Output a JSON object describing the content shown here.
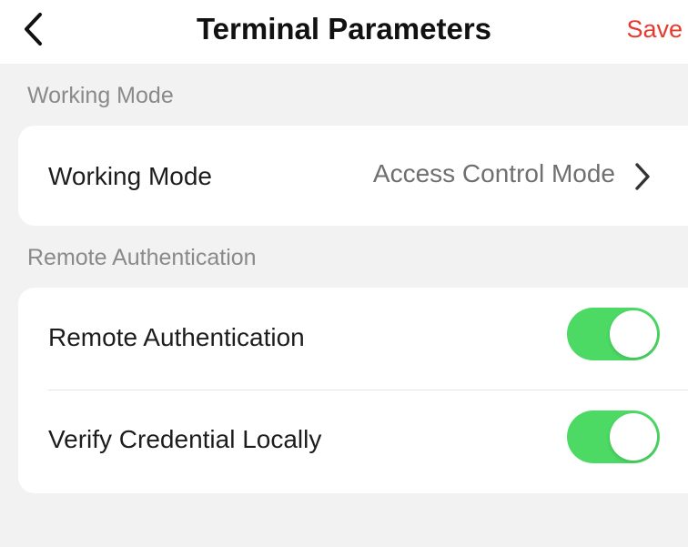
{
  "header": {
    "title": "Terminal Parameters",
    "save_label": "Save",
    "back_icon": "chevron-left-icon"
  },
  "colors": {
    "accent": "#e63a2e",
    "toggle_on": "#4cd964",
    "background": "#f2f2f2"
  },
  "sections": [
    {
      "label": "Working Mode",
      "rows": [
        {
          "label": "Working Mode",
          "value": "Access Control Mode",
          "icon": "chevron-right-icon"
        }
      ]
    },
    {
      "label": "Remote Authentication",
      "rows": [
        {
          "label": "Remote Authentication",
          "toggle_on": true
        },
        {
          "label": "Verify Credential Locally",
          "toggle_on": true
        }
      ]
    }
  ]
}
